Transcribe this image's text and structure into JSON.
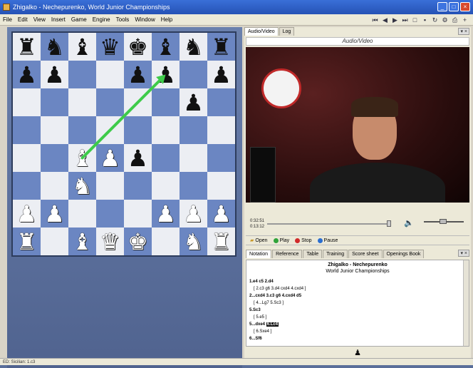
{
  "window": {
    "title": "Zhigalko - Nechepurenko, World Junior Championships"
  },
  "menu": [
    "File",
    "Edit",
    "View",
    "Insert",
    "Game",
    "Engine",
    "Tools",
    "Window",
    "Help"
  ],
  "board": {
    "ranks": [
      [
        "br",
        "bn",
        "bb",
        "bq",
        "bk",
        "bb",
        "bn",
        "br"
      ],
      [
        "bp",
        "bp",
        "",
        "",
        "bp",
        "bp",
        "",
        "bp"
      ],
      [
        "",
        "",
        "",
        "",
        "",
        "",
        "bp",
        ""
      ],
      [
        "",
        "",
        "",
        "",
        "",
        "",
        "",
        ""
      ],
      [
        "",
        "",
        "wb",
        "wp",
        "bp",
        "",
        "",
        ""
      ],
      [
        "",
        "",
        "wn",
        "",
        "",
        "",
        "",
        ""
      ],
      [
        "wp",
        "wp",
        "",
        "",
        "",
        "wp",
        "wp",
        "wp"
      ],
      [
        "wr",
        "",
        "wb",
        "wq",
        "wk",
        "",
        "wn",
        "wr"
      ]
    ],
    "arrow": {
      "from": "c4",
      "to": "f7",
      "color": "#3ecb4a"
    }
  },
  "video_panel": {
    "tabs": [
      "Audio/Video",
      "Log"
    ],
    "header": "Audio/Video",
    "time_elapsed": "0:32:51",
    "time_total": "0:13:12"
  },
  "playbar": {
    "open": "Open",
    "play": "Play",
    "stop": "Stop",
    "pause": "Pause"
  },
  "notation_panel": {
    "tabs": [
      "Notation",
      "Reference",
      "Table",
      "Training",
      "Score sheet",
      "Openings Book"
    ],
    "white": "Zhigalko - Nechepurenko",
    "event": "World Junior Championships",
    "lines": [
      {
        "type": "main",
        "text": "1.e4  c5  2.d4"
      },
      {
        "type": "var",
        "text": "[ 2.c3  g6  3.d4  cxd4  4.cxd4 ]"
      },
      {
        "type": "main",
        "text": "2...cxd4  3.c3  g6  4.cxd4  d5"
      },
      {
        "type": "var",
        "text": "[ 4...Lg7  5.Sc3 ]"
      },
      {
        "type": "main",
        "text": "5.Sc3"
      },
      {
        "type": "var",
        "text": "[ 5.e5 ]"
      },
      {
        "type": "cur",
        "pre": "5...dxe4",
        "current": "6.Lc4"
      },
      {
        "type": "var",
        "text": "[ 6.Sxe4 ]"
      },
      {
        "type": "main",
        "text": "6...Sf6"
      }
    ]
  },
  "statusbar": {
    "text": "ED: Sicilian: 1.c3"
  }
}
